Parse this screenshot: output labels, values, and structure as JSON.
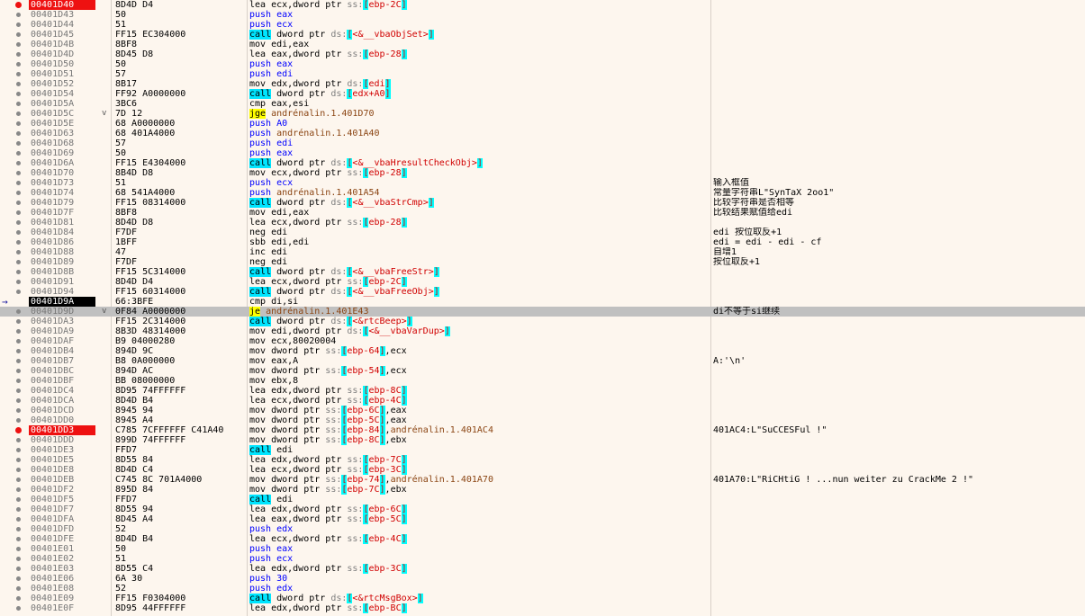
{
  "rows": [
    {
      "addr": "00401D40",
      "bytes": "8D4D D4",
      "instr": "lea ecx,dword ptr ss:[ebp-2C]",
      "comment": "",
      "addr_style": "bp",
      "gutter": "bp"
    },
    {
      "addr": "00401D43",
      "bytes": "50",
      "instr": "push eax",
      "comment": ""
    },
    {
      "addr": "00401D44",
      "bytes": "51",
      "instr": "push ecx",
      "comment": ""
    },
    {
      "addr": "00401D45",
      "bytes": "FF15 EC304000",
      "instr": "call dword ptr ds:[<&__vbaObjSet>]",
      "comment": ""
    },
    {
      "addr": "00401D4B",
      "bytes": "8BF8",
      "instr": "mov edi,eax",
      "comment": ""
    },
    {
      "addr": "00401D4D",
      "bytes": "8D45 D8",
      "instr": "lea eax,dword ptr ss:[ebp-28]",
      "comment": ""
    },
    {
      "addr": "00401D50",
      "bytes": "50",
      "instr": "push eax",
      "comment": ""
    },
    {
      "addr": "00401D51",
      "bytes": "57",
      "instr": "push edi",
      "comment": ""
    },
    {
      "addr": "00401D52",
      "bytes": "8B17",
      "instr": "mov edx,dword ptr ds:[edi]",
      "comment": ""
    },
    {
      "addr": "00401D54",
      "bytes": "FF92 A0000000",
      "instr": "call dword ptr ds:[edx+A0]",
      "comment": ""
    },
    {
      "addr": "00401D5A",
      "bytes": "3BC6",
      "instr": "cmp eax,esi",
      "comment": ""
    },
    {
      "addr": "00401D5C",
      "bytes": "7D 12",
      "instr": "jge andrénalin.1.401D70",
      "comment": "",
      "jumpmark": "v"
    },
    {
      "addr": "00401D5E",
      "bytes": "68 A0000000",
      "instr": "push A0",
      "comment": ""
    },
    {
      "addr": "00401D63",
      "bytes": "68 401A4000",
      "instr": "push andrénalin.1.401A40",
      "comment": ""
    },
    {
      "addr": "00401D68",
      "bytes": "57",
      "instr": "push edi",
      "comment": ""
    },
    {
      "addr": "00401D69",
      "bytes": "50",
      "instr": "push eax",
      "comment": ""
    },
    {
      "addr": "00401D6A",
      "bytes": "FF15 E4304000",
      "instr": "call dword ptr ds:[<&__vbaHresultCheckObj>]",
      "comment": ""
    },
    {
      "addr": "00401D70",
      "bytes": "8B4D D8",
      "instr": "mov ecx,dword ptr ss:[ebp-28]",
      "comment": ""
    },
    {
      "addr": "00401D73",
      "bytes": "51",
      "instr": "push ecx",
      "comment": "输入框值"
    },
    {
      "addr": "00401D74",
      "bytes": "68 541A4000",
      "instr": "push andrénalin.1.401A54",
      "comment": "常量字符串L\"SynTaX 2oo1\""
    },
    {
      "addr": "00401D79",
      "bytes": "FF15 08314000",
      "instr": "call dword ptr ds:[<&__vbaStrCmp>]",
      "comment": "比较字符串是否相等"
    },
    {
      "addr": "00401D7F",
      "bytes": "8BF8",
      "instr": "mov edi,eax",
      "comment": "比较结果赋值给edi"
    },
    {
      "addr": "00401D81",
      "bytes": "8D4D D8",
      "instr": "lea ecx,dword ptr ss:[ebp-28]",
      "comment": ""
    },
    {
      "addr": "00401D84",
      "bytes": "F7DF",
      "instr": "neg edi",
      "comment": "edi 按位取反+1"
    },
    {
      "addr": "00401D86",
      "bytes": "1BFF",
      "instr": "sbb edi,edi",
      "comment": "edi = edi - edi - cf"
    },
    {
      "addr": "00401D88",
      "bytes": "47",
      "instr": "inc edi",
      "comment": "自增1"
    },
    {
      "addr": "00401D89",
      "bytes": "F7DF",
      "instr": "neg edi",
      "comment": "按位取反+1"
    },
    {
      "addr": "00401D8B",
      "bytes": "FF15 5C314000",
      "instr": "call dword ptr ds:[<&__vbaFreeStr>]",
      "comment": ""
    },
    {
      "addr": "00401D91",
      "bytes": "8D4D D4",
      "instr": "lea ecx,dword ptr ss:[ebp-2C]",
      "comment": ""
    },
    {
      "addr": "00401D94",
      "bytes": "FF15 60314000",
      "instr": "call dword ptr ds:[<&__vbaFreeObj>]",
      "comment": ""
    },
    {
      "addr": "00401D9A",
      "bytes": "66:3BFE",
      "instr": "cmp di,si",
      "comment": "",
      "addr_style": "eip",
      "gutter": "eip"
    },
    {
      "addr": "00401D9D",
      "bytes": "0F84 A0000000",
      "instr": "je andrénalin.1.401E43",
      "comment": "di不等于si继续",
      "highlight": true,
      "jumpmark": "v"
    },
    {
      "addr": "00401DA3",
      "bytes": "FF15 2C314000",
      "instr": "call dword ptr ds:[<&rtcBeep>]",
      "comment": ""
    },
    {
      "addr": "00401DA9",
      "bytes": "8B3D 48314000",
      "instr": "mov edi,dword ptr ds:[<&__vbaVarDup>]",
      "comment": ""
    },
    {
      "addr": "00401DAF",
      "bytes": "B9 04000280",
      "instr": "mov ecx,80020004",
      "comment": ""
    },
    {
      "addr": "00401DB4",
      "bytes": "894D 9C",
      "instr": "mov dword ptr ss:[ebp-64],ecx",
      "comment": ""
    },
    {
      "addr": "00401DB7",
      "bytes": "B8 0A000000",
      "instr": "mov eax,A",
      "comment": "A:'\\n'"
    },
    {
      "addr": "00401DBC",
      "bytes": "894D AC",
      "instr": "mov dword ptr ss:[ebp-54],ecx",
      "comment": ""
    },
    {
      "addr": "00401DBF",
      "bytes": "BB 08000000",
      "instr": "mov ebx,8",
      "comment": ""
    },
    {
      "addr": "00401DC4",
      "bytes": "8D95 74FFFFFF",
      "instr": "lea edx,dword ptr ss:[ebp-8C]",
      "comment": ""
    },
    {
      "addr": "00401DCA",
      "bytes": "8D4D B4",
      "instr": "lea ecx,dword ptr ss:[ebp-4C]",
      "comment": ""
    },
    {
      "addr": "00401DCD",
      "bytes": "8945 94",
      "instr": "mov dword ptr ss:[ebp-6C],eax",
      "comment": ""
    },
    {
      "addr": "00401DD0",
      "bytes": "8945 A4",
      "instr": "mov dword ptr ss:[ebp-5C],eax",
      "comment": ""
    },
    {
      "addr": "00401DD3",
      "bytes": "C785 7CFFFFFF C41A40",
      "instr": "mov dword ptr ss:[ebp-84],andrénalin.1.401AC4",
      "comment": "401AC4:L\"SuCCESFul !\"",
      "addr_style": "bp",
      "gutter": "bp"
    },
    {
      "addr": "00401DDD",
      "bytes": "899D 74FFFFFF",
      "instr": "mov dword ptr ss:[ebp-8C],ebx",
      "comment": ""
    },
    {
      "addr": "00401DE3",
      "bytes": "FFD7",
      "instr": "call edi",
      "comment": ""
    },
    {
      "addr": "00401DE5",
      "bytes": "8D55 84",
      "instr": "lea edx,dword ptr ss:[ebp-7C]",
      "comment": ""
    },
    {
      "addr": "00401DE8",
      "bytes": "8D4D C4",
      "instr": "lea ecx,dword ptr ss:[ebp-3C]",
      "comment": ""
    },
    {
      "addr": "00401DEB",
      "bytes": "C745 8C 701A4000",
      "instr": "mov dword ptr ss:[ebp-74],andrénalin.1.401A70",
      "comment": "401A70:L\"RiCHtiG ! ...nun weiter zu CrackMe 2 !\""
    },
    {
      "addr": "00401DF2",
      "bytes": "895D 84",
      "instr": "mov dword ptr ss:[ebp-7C],ebx",
      "comment": ""
    },
    {
      "addr": "00401DF5",
      "bytes": "FFD7",
      "instr": "call edi",
      "comment": ""
    },
    {
      "addr": "00401DF7",
      "bytes": "8D55 94",
      "instr": "lea edx,dword ptr ss:[ebp-6C]",
      "comment": ""
    },
    {
      "addr": "00401DFA",
      "bytes": "8D45 A4",
      "instr": "lea eax,dword ptr ss:[ebp-5C]",
      "comment": ""
    },
    {
      "addr": "00401DFD",
      "bytes": "52",
      "instr": "push edx",
      "comment": ""
    },
    {
      "addr": "00401DFE",
      "bytes": "8D4D B4",
      "instr": "lea ecx,dword ptr ss:[ebp-4C]",
      "comment": ""
    },
    {
      "addr": "00401E01",
      "bytes": "50",
      "instr": "push eax",
      "comment": ""
    },
    {
      "addr": "00401E02",
      "bytes": "51",
      "instr": "push ecx",
      "comment": ""
    },
    {
      "addr": "00401E03",
      "bytes": "8D55 C4",
      "instr": "lea edx,dword ptr ss:[ebp-3C]",
      "comment": ""
    },
    {
      "addr": "00401E06",
      "bytes": "6A 30",
      "instr": "push 30",
      "comment": ""
    },
    {
      "addr": "00401E08",
      "bytes": "52",
      "instr": "push edx",
      "comment": ""
    },
    {
      "addr": "00401E09",
      "bytes": "FF15 F0304000",
      "instr": "call dword ptr ds:[<&rtcMsgBox>]",
      "comment": ""
    },
    {
      "addr": "00401E0F",
      "bytes": "8D95 44FFFFFF",
      "instr": "lea edx,dword ptr ss:[ebp-BC]",
      "comment": ""
    }
  ],
  "colors": {
    "background": "#fdf6ee",
    "breakpoint": "#ee1111",
    "eip": "#000000",
    "highlight_row": "#c0c0c0",
    "call_bg": "#00e5ff",
    "jump_bg": "#ffff00"
  }
}
